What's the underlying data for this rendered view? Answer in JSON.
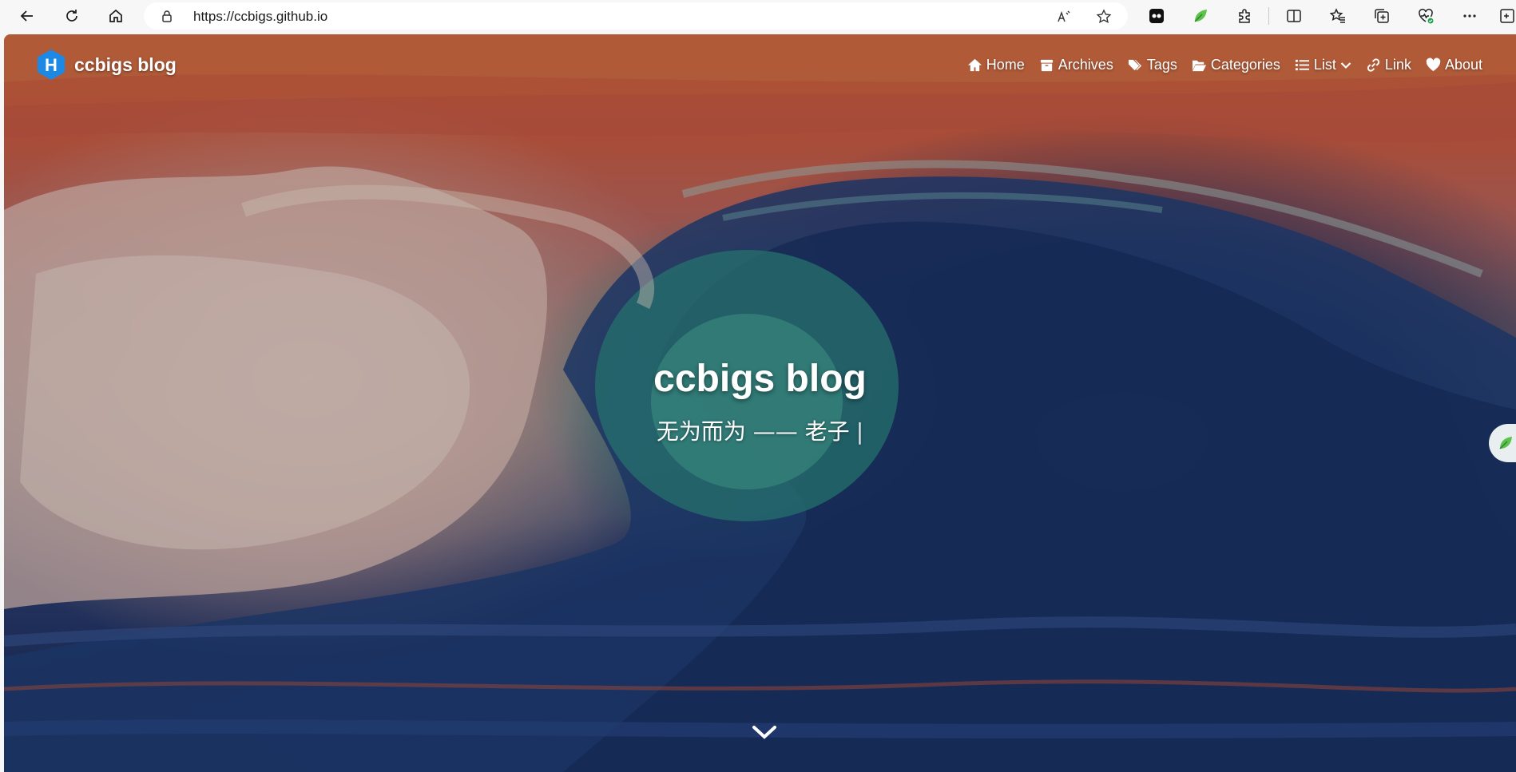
{
  "browser": {
    "url": "https://ccbigs.github.io",
    "controls": [
      "back-icon",
      "refresh-icon",
      "home-icon"
    ],
    "address_icons": [
      "read-aloud-icon",
      "favorite-star-icon"
    ],
    "toolbar_icons": [
      "extension-icon",
      "leaf-extension-icon",
      "puzzle-extensions-icon",
      "split-screen-icon",
      "favorites-icon",
      "collections-icon",
      "browser-health-icon",
      "more-menu-icon",
      "sidebar-icon"
    ]
  },
  "site": {
    "brand": "ccbigs blog",
    "logo_letter": "H",
    "title": "ccbigs blog",
    "subtitle": "无为而为 —— 老子",
    "typing_cursor": "|"
  },
  "nav": {
    "items": [
      {
        "label": "Home",
        "icon": "home-icon"
      },
      {
        "label": "Archives",
        "icon": "archive-icon"
      },
      {
        "label": "Tags",
        "icon": "tags-icon"
      },
      {
        "label": "Categories",
        "icon": "folder-open-icon"
      },
      {
        "label": "List",
        "icon": "list-icon"
      },
      {
        "label": "Link",
        "icon": "link-icon"
      },
      {
        "label": "About",
        "icon": "heart-icon"
      }
    ]
  },
  "colors": {
    "accent": "#1e88e5",
    "sky": "#d6673f",
    "wave": "#1f3f76",
    "foam": "#3fa08f"
  }
}
